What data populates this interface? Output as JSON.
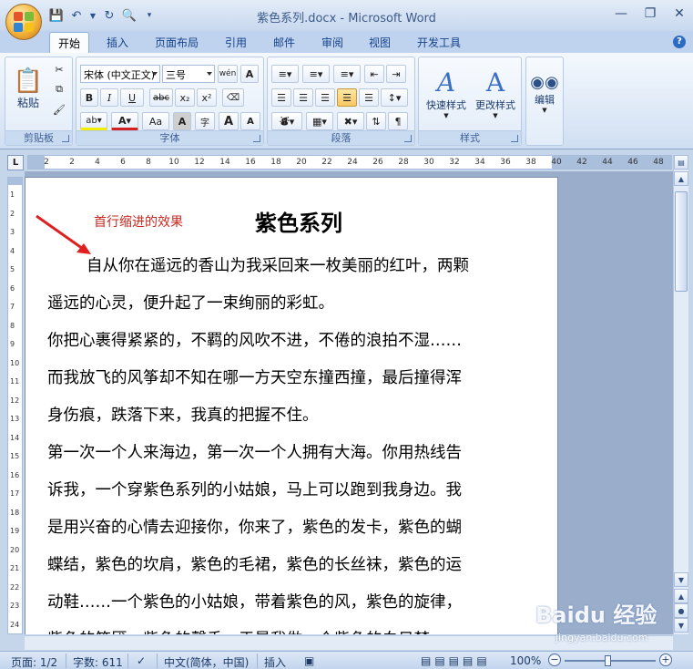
{
  "window": {
    "title": "紫色系列.docx - Microsoft Word"
  },
  "tabs": [
    "开始",
    "插入",
    "页面布局",
    "引用",
    "邮件",
    "审阅",
    "视图",
    "开发工具"
  ],
  "ribbon": {
    "clipboard": {
      "label": "剪贴板",
      "paste": "粘贴"
    },
    "font": {
      "label": "字体",
      "font_name": "宋体 (中文正文)",
      "font_size": "三号",
      "wen": "wén",
      "bold": "B",
      "italic": "I",
      "underline": "U",
      "strike": "abc",
      "subscript": "x₂",
      "superscript": "x²",
      "char_scale": "Aa",
      "grow": "A",
      "shrink": "A",
      "text_effect": "A",
      "enclose": "字"
    },
    "paragraph": {
      "label": "段落"
    },
    "styles": {
      "label": "样式",
      "quick_styles": "快速样式",
      "change_styles": "更改样式"
    },
    "editing": {
      "label": "编辑"
    }
  },
  "ruler": {
    "h_ticks": [
      "2",
      "2",
      "4",
      "6",
      "8",
      "10",
      "12",
      "14",
      "16",
      "18",
      "20",
      "22",
      "24",
      "26",
      "28",
      "30",
      "32",
      "34",
      "36",
      "38",
      "40",
      "42",
      "44",
      "46",
      "48"
    ],
    "v_ticks": [
      "1",
      "2",
      "3",
      "4",
      "5",
      "6",
      "7",
      "8",
      "9",
      "10",
      "11",
      "12",
      "13",
      "14",
      "15",
      "16",
      "17",
      "18",
      "19",
      "20",
      "21",
      "22",
      "23",
      "24"
    ]
  },
  "document": {
    "annotation": "首行缩进的效果",
    "title": "紫色系列",
    "lines": [
      {
        "text": "自从你在遥远的香山为我采回来一枚美丽的红叶，两颗",
        "indent": true
      },
      {
        "text": "遥远的心灵，便升起了一束绚丽的彩虹。",
        "indent": false
      },
      {
        "text": "你把心裹得紧紧的，不羁的风吹不进，不倦的浪拍不湿……",
        "indent": false
      },
      {
        "text": "而我放飞的风筝却不知在哪一方天空东撞西撞，最后撞得浑",
        "indent": false
      },
      {
        "text": "身伤痕，跌落下来，我真的把握不住。",
        "indent": false
      },
      {
        "text": "第一次一个人来海边，第一次一个人拥有大海。你用热线告",
        "indent": false
      },
      {
        "text": "诉我，一个穿紫色系列的小姑娘，马上可以跑到我身边。我",
        "indent": false
      },
      {
        "text": "是用兴奋的心情去迎接你，你来了，紫色的发卡，紫色的蝴",
        "indent": false
      },
      {
        "text": "蝶结，紫色的坎肩，紫色的毛裙，紫色的长丝袜，紫色的运",
        "indent": false
      },
      {
        "text": "动鞋……一个紫色的小姑娘，带着紫色的风，紫色的旋律，",
        "indent": false
      },
      {
        "text": "紫色的笑靥，紫色的馨香，于是我做一个紫色的白日梦",
        "indent": false
      }
    ]
  },
  "status": {
    "page": "页面: 1/2",
    "words": "字数: 611",
    "language": "中文(简体，中国)",
    "mode": "插入",
    "zoom": "100%"
  },
  "watermark": {
    "brand": "Baidu 经验",
    "url": "jingyan.baidu.com"
  },
  "colors": {
    "annotation": "#c8281e",
    "ribbon_bg": "#dbe7f6",
    "title_text": "#3c5a8a"
  }
}
